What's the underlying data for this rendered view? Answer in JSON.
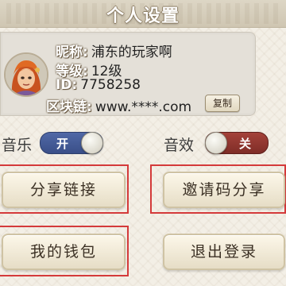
{
  "title": "个人设置",
  "profile": {
    "nickname_label": "昵称:",
    "nickname": "浦东的玩家啊",
    "level_label": "等级:",
    "level": "12级",
    "id_label": "ID:",
    "id": "7758258",
    "chain_label": "区块链:",
    "chain": "www.****.com",
    "copy_label": "复制"
  },
  "toggles": {
    "music_label": "音乐",
    "music_state": "开",
    "sound_label": "音效",
    "sound_state": "关"
  },
  "buttons": {
    "share_link": "分享链接",
    "invite_share": "邀请码分享",
    "wallet": "我的钱包",
    "logout": "退出登录"
  },
  "colors": {
    "toggle_on": "#3a4f88",
    "toggle_off": "#7f2d27",
    "highlight_box": "#d43a3a"
  }
}
